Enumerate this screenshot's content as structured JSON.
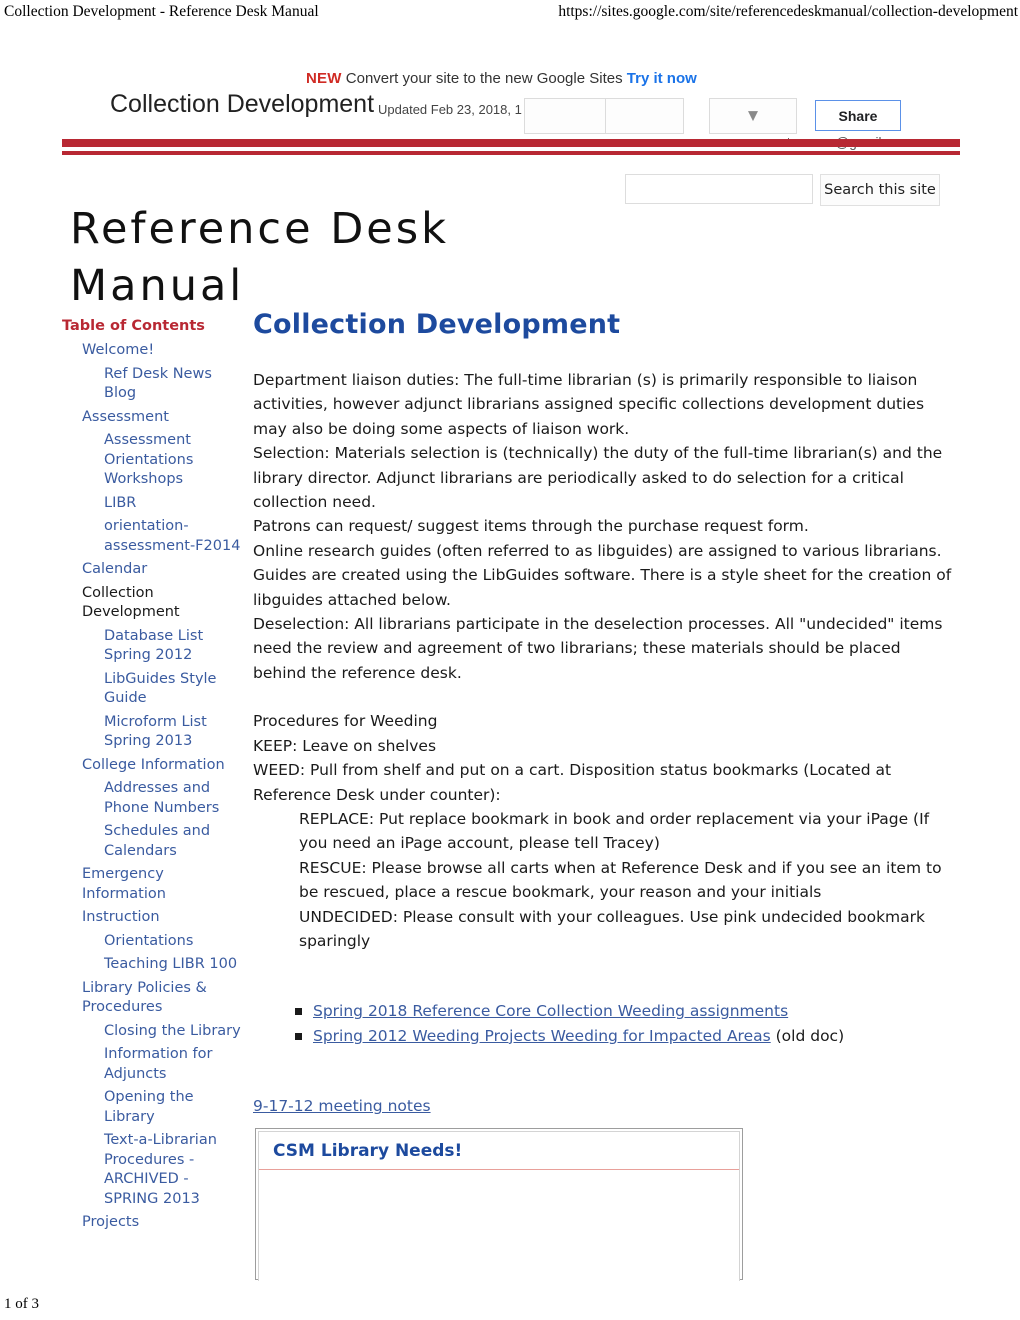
{
  "print_header": {
    "left": "Collection Development - Reference Desk Manual",
    "right": "https://sites.google.com/site/referencedeskmanual/collection-development"
  },
  "google_bar": {
    "new_tag": "NEW",
    "promo_text": "Convert your site to the new Google Sites",
    "try_link": "Try it now",
    "account_email": "csmteresam@gmail.com",
    "account_caret": "▼",
    "site_name": "Collection Development",
    "updated_text": "Updated Feb 23, 2018, 1",
    "more_caret": "▼",
    "share_label": "Share"
  },
  "header": {
    "site_title": "Reference Desk Manual",
    "accent_color": "#b82833"
  },
  "search": {
    "value": "",
    "placeholder": "",
    "button_label": "Search this site"
  },
  "sidebar": {
    "heading": "Table of Contents",
    "items": [
      {
        "label": "Welcome!",
        "level": 1,
        "current": false
      },
      {
        "label": "Ref Desk News Blog",
        "level": 2,
        "current": false
      },
      {
        "label": "Assessment",
        "level": 1,
        "current": false
      },
      {
        "label": "Assessment Orientations Workshops",
        "level": 2,
        "current": false
      },
      {
        "label": "LIBR",
        "level": 2,
        "current": false
      },
      {
        "label": "orientation-assessment-F2014",
        "level": 2,
        "current": false
      },
      {
        "label": "Calendar",
        "level": 1,
        "current": false
      },
      {
        "label": "Collection Development",
        "level": 1,
        "current": true
      },
      {
        "label": "Database List Spring 2012",
        "level": 2,
        "current": false
      },
      {
        "label": "LibGuides Style Guide",
        "level": 2,
        "current": false
      },
      {
        "label": "Microform List Spring 2013",
        "level": 2,
        "current": false
      },
      {
        "label": "College Information",
        "level": 1,
        "current": false
      },
      {
        "label": "Addresses and Phone Numbers",
        "level": 2,
        "current": false
      },
      {
        "label": "Schedules and Calendars",
        "level": 2,
        "current": false
      },
      {
        "label": "Emergency Information",
        "level": 1,
        "current": false
      },
      {
        "label": "Instruction",
        "level": 1,
        "current": false
      },
      {
        "label": "Orientations",
        "level": 2,
        "current": false
      },
      {
        "label": "Teaching LIBR 100",
        "level": 2,
        "current": false
      },
      {
        "label": "Library Policies & Procedures",
        "level": 1,
        "current": false
      },
      {
        "label": "Closing the Library",
        "level": 2,
        "current": false
      },
      {
        "label": "Information for Adjuncts",
        "level": 2,
        "current": false
      },
      {
        "label": "Opening the Library",
        "level": 2,
        "current": false
      },
      {
        "label": "Text-a-Librarian Procedures -ARCHIVED - SPRING 2013",
        "level": 2,
        "current": false
      },
      {
        "label": "Projects",
        "level": 1,
        "current": false
      }
    ]
  },
  "main": {
    "title": "Collection Development",
    "para_liaison": "Department liaison duties: The full-time librarian (s) is primarily responsible to liaison activities, however adjunct librarians assigned specific collections development duties may also be doing some aspects of liaison work.",
    "para_selection": "Selection:  Materials selection is (technically) the duty of the full-time librarian(s) and the library director. Adjunct librarians are periodically asked to do selection for a critical collection need.",
    "para_patrons": "Patrons can request/ suggest items through the purchase request form.",
    "para_guides": "Online research guides (often referred to as libguides) are assigned to various librarians. Guides are created using the LibGuides software. There is a style sheet for the creation of libguides attached below.",
    "para_deselection": "Deselection: All librarians participate in the deselection processes. All \"undecided\" items need the review and agreement of two librarians; these materials should be placed behind the reference desk.",
    "weeding_heading": "Procedures for Weeding",
    "weeding_keep": "KEEP:  Leave on shelves",
    "weeding_weed": "WEED:  Pull from shelf and put on a cart. Disposition status bookmarks  (Located at Reference Desk under counter):",
    "weeding_replace": "REPLACE:  Put replace bookmark in book and order replacement via your iPage  (If you need an iPage account, please tell Tracey)",
    "weeding_rescue": "RESCUE:  Please browse all carts when at Reference Desk and if you see an item to be rescued, place a rescue bookmark, your reason and your initials",
    "weeding_undecided": "UNDECIDED:  Please consult with your colleagues.  Use pink undecided bookmark sparingly",
    "links": [
      {
        "text": "Spring 2018 Reference Core Collection Weeding assignments",
        "suffix": ""
      },
      {
        "text": "Spring 2012 Weeding Projects Weeding for Impacted Areas",
        "suffix": " (old doc)"
      }
    ],
    "meeting_notes_link": "9-17-12 meeting notes",
    "gadget_title": "CSM Library Needs!"
  },
  "footer": {
    "page_indicator": "1 of 3"
  }
}
